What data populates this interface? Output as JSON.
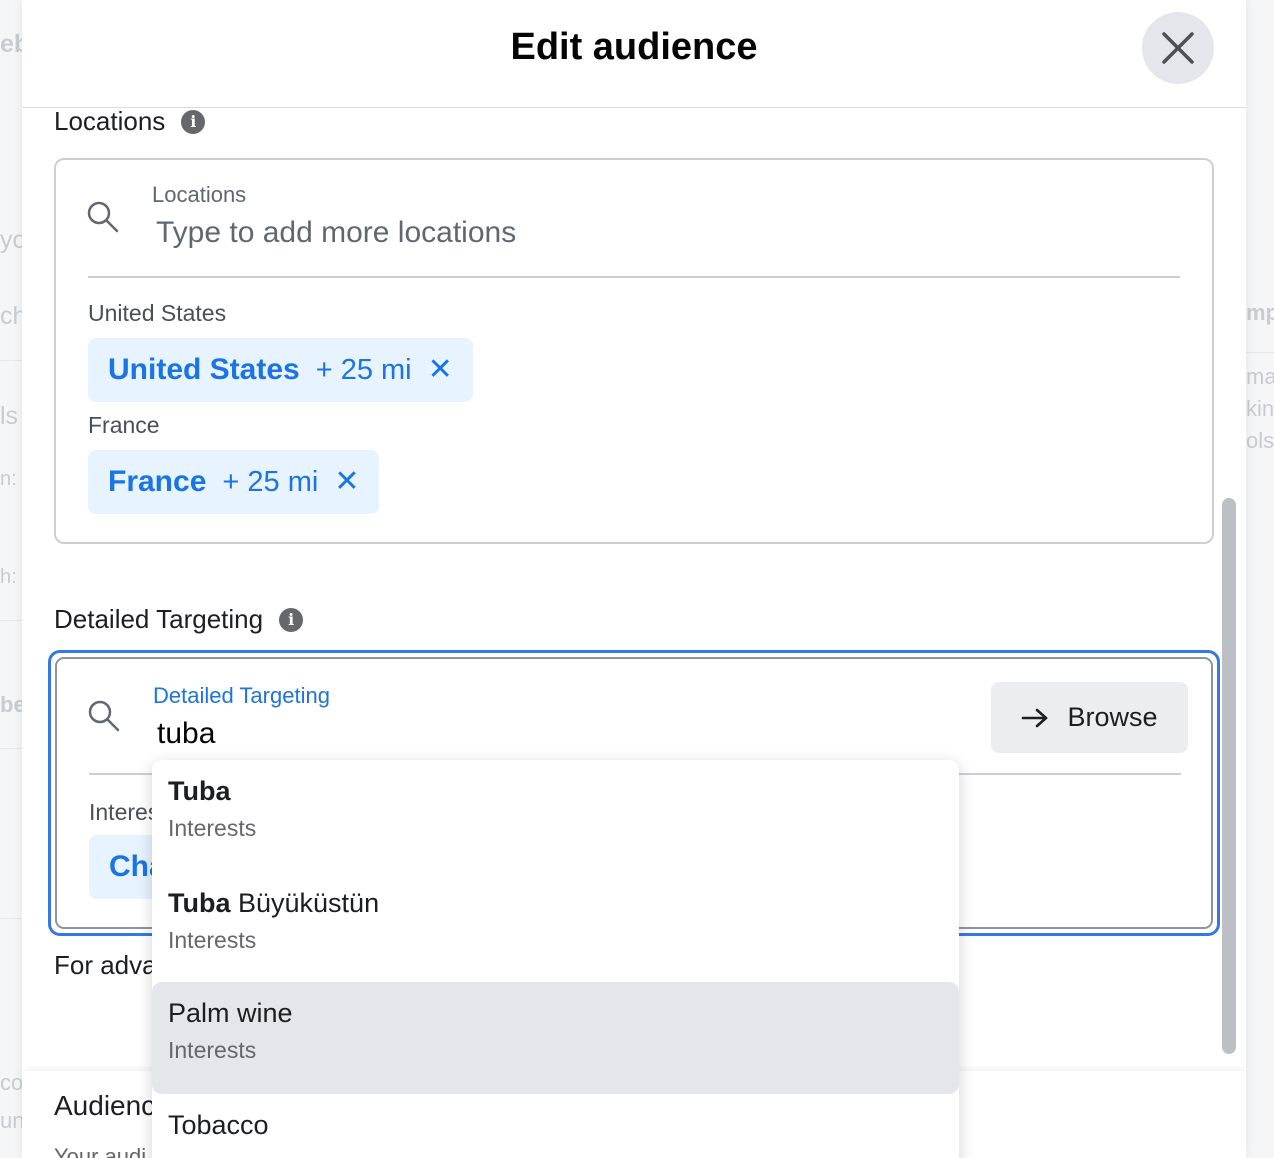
{
  "background": {
    "fragments": [
      "eb",
      "yo",
      "ch",
      "ls",
      "n: I",
      "h:",
      "be",
      "mp",
      "ma",
      "kin",
      "ols",
      "co",
      "un"
    ]
  },
  "modal": {
    "title": "Edit audience",
    "close_icon": "close-icon"
  },
  "locations": {
    "section_label": "Locations",
    "field_label": "Locations",
    "placeholder": "Type to add more locations",
    "groups": [
      {
        "label": "United States",
        "chip_name": "United States",
        "radius": "+ 25 mi"
      },
      {
        "label": "France",
        "chip_name": "France",
        "radius": "+ 25 mi"
      }
    ]
  },
  "detailed_targeting": {
    "section_label": "Detailed Targeting",
    "field_label": "Detailed Targeting",
    "value": "tuba",
    "browse_label": "Browse",
    "hidden_group_label": "Interes",
    "hidden_chip": "Cha"
  },
  "for_advanced": "For adva",
  "audience_section": {
    "label": "Audienc",
    "sub": "Your audi"
  },
  "dropdown": {
    "items": [
      {
        "bold": "Tuba",
        "rest": "",
        "sub": "Interests"
      },
      {
        "bold": "Tuba",
        "rest": " Büyüküstün",
        "sub": "Interests"
      },
      {
        "bold": "",
        "rest": "Palm wine",
        "sub": "Interests"
      },
      {
        "bold": "",
        "rest": "Tobacco",
        "sub": ""
      }
    ]
  },
  "colors": {
    "accent": "#1b74e4",
    "chip_bg": "#e7f3ff",
    "focus_border": "#3578e5"
  }
}
